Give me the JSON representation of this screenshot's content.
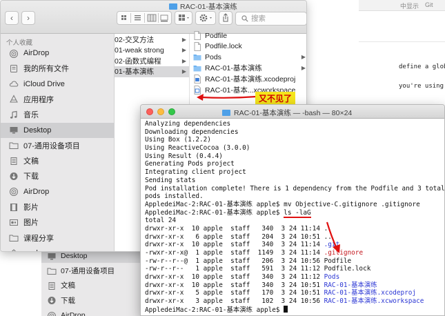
{
  "background_page": {
    "top_text_1": "中显示",
    "top_text_2": "Git",
    "line_1": "define a globa",
    "line_2": "you're using S"
  },
  "finder": {
    "title": "RAC-01-基本演练",
    "search_placeholder": "搜索",
    "toolbar": {
      "back": "‹",
      "forward": "›"
    },
    "sidebar": {
      "section_favorites": "个人收藏",
      "items": [
        {
          "label": "AirDrop",
          "icon": "airdrop-icon"
        },
        {
          "label": "我的所有文件",
          "icon": "all-files-icon"
        },
        {
          "label": "iCloud Drive",
          "icon": "cloud-icon"
        },
        {
          "label": "应用程序",
          "icon": "applications-icon"
        },
        {
          "label": "音乐",
          "icon": "music-icon"
        },
        {
          "label": "Desktop",
          "icon": "desktop-icon",
          "selected": true
        },
        {
          "label": "07-通用设备项目",
          "icon": "folder-icon"
        },
        {
          "label": "文稿",
          "icon": "documents-icon"
        },
        {
          "label": "下载",
          "icon": "downloads-icon"
        },
        {
          "label": "AirDrop",
          "icon": "airdrop-icon"
        },
        {
          "label": "影片",
          "icon": "movies-icon"
        },
        {
          "label": "图片",
          "icon": "pictures-icon"
        },
        {
          "label": "课程分享",
          "icon": "folder-icon"
        },
        {
          "label": "apple",
          "icon": "home-icon"
        }
      ]
    },
    "column_1": [
      {
        "label": "02-交叉方法"
      },
      {
        "label": "01-weak strong"
      },
      {
        "label": "02-函数式编程"
      },
      {
        "label": "01-基本演练",
        "selected": true
      }
    ],
    "column_2": [
      {
        "label": "Podfile",
        "icon": "file-icon"
      },
      {
        "label": "Podfile.lock",
        "icon": "file-icon"
      },
      {
        "label": "Pods",
        "icon": "folder-icon",
        "chevron": true
      },
      {
        "label": "RAC-01-基本演练",
        "icon": "folder-icon",
        "chevron": true
      },
      {
        "label": "RAC-01-基本演练.xcodeproj",
        "icon": "xcodeproj-icon"
      },
      {
        "label": "RAC-01-基本...xcworkspace",
        "icon": "xcworkspace-icon"
      }
    ]
  },
  "behind_sidebar": {
    "items": [
      {
        "label": "Desktop",
        "icon": "desktop-icon",
        "selected": true
      },
      {
        "label": "07-通用设备项目",
        "icon": "folder-icon"
      },
      {
        "label": "文稿",
        "icon": "documents-icon"
      },
      {
        "label": "下载",
        "icon": "downloads-icon"
      },
      {
        "label": "AirDrop",
        "icon": "airdrop-icon"
      }
    ]
  },
  "annotation": {
    "label": "又不见了",
    "bg_color": "#f5e51c",
    "text_color": "#d10000"
  },
  "terminal": {
    "title": "RAC-01-基本演练 — -bash — 80×24",
    "lines": [
      [
        {
          "t": "Analyzing dependencies"
        }
      ],
      [
        {
          "t": "Downloading dependencies"
        }
      ],
      [
        {
          "t": "Using Box (1.2.2)"
        }
      ],
      [
        {
          "t": "Using ReactiveCocoa (3.0.0)"
        }
      ],
      [
        {
          "t": "Using Result (0.4.4)"
        }
      ],
      [
        {
          "t": "Generating Pods project"
        }
      ],
      [
        {
          "t": "Integrating client project"
        }
      ],
      [
        {
          "t": "Sending stats"
        }
      ],
      [
        {
          "t": "Pod installation complete! There is 1 dependency from the Podfile and 3 total"
        }
      ],
      [
        {
          "t": "pods installed."
        }
      ],
      [
        {
          "t": "AppledeiMac-2:RAC-01-基本演练 apple$ mv Objective-C.gitignore .gitignore"
        }
      ],
      [
        {
          "t": "AppledeiMac-2:RAC-01-基本演练 apple$ ls -laG"
        }
      ],
      [
        {
          "t": "total 24"
        }
      ],
      [
        {
          "t": "drwxr-xr-x  10 apple  staff   340  3 24 11:14 ."
        }
      ],
      [
        {
          "t": "drwxr-xr-x   6 apple  staff   204  3 24 10:51 .."
        }
      ],
      [
        {
          "t": "drwxr-xr-x  10 apple  staff   340  3 24 11:14 "
        },
        {
          "t": ".git",
          "c": "blue"
        }
      ],
      [
        {
          "t": "-rwxr-xr-x@  1 apple  staff  1149  3 24 11:14 "
        },
        {
          "t": ".gitignore",
          "c": "red"
        }
      ],
      [
        {
          "t": "-rw-r--r--@  1 apple  staff   206  3 24 10:56 Podfile"
        }
      ],
      [
        {
          "t": "-rw-r--r--   1 apple  staff   591  3 24 11:12 Podfile.lock"
        }
      ],
      [
        {
          "t": "drwxr-xr-x  10 apple  staff   340  3 24 11:12 "
        },
        {
          "t": "Pods",
          "c": "blue"
        }
      ],
      [
        {
          "t": "drwxr-xr-x  10 apple  staff   340  3 24 10:51 "
        },
        {
          "t": "RAC-01-基本演练",
          "c": "blue"
        }
      ],
      [
        {
          "t": "drwxr-xr-x   5 apple  staff   170  3 24 10:51 "
        },
        {
          "t": "RAC-01-基本演练.xcodeproj",
          "c": "blue"
        }
      ],
      [
        {
          "t": "drwxr-xr-x   3 apple  staff   102  3 24 10:56 "
        },
        {
          "t": "RAC-01-基本演练.xcworkspace",
          "c": "blue"
        }
      ],
      [
        {
          "t": "AppledeiMac-2:RAC-01-基本演练 apple$ "
        }
      ]
    ]
  },
  "colors": {
    "traffic_red": "#fc605b",
    "traffic_yellow": "#fdbc40",
    "traffic_green": "#34c84a",
    "folder_blue": "#4ea0e8"
  }
}
